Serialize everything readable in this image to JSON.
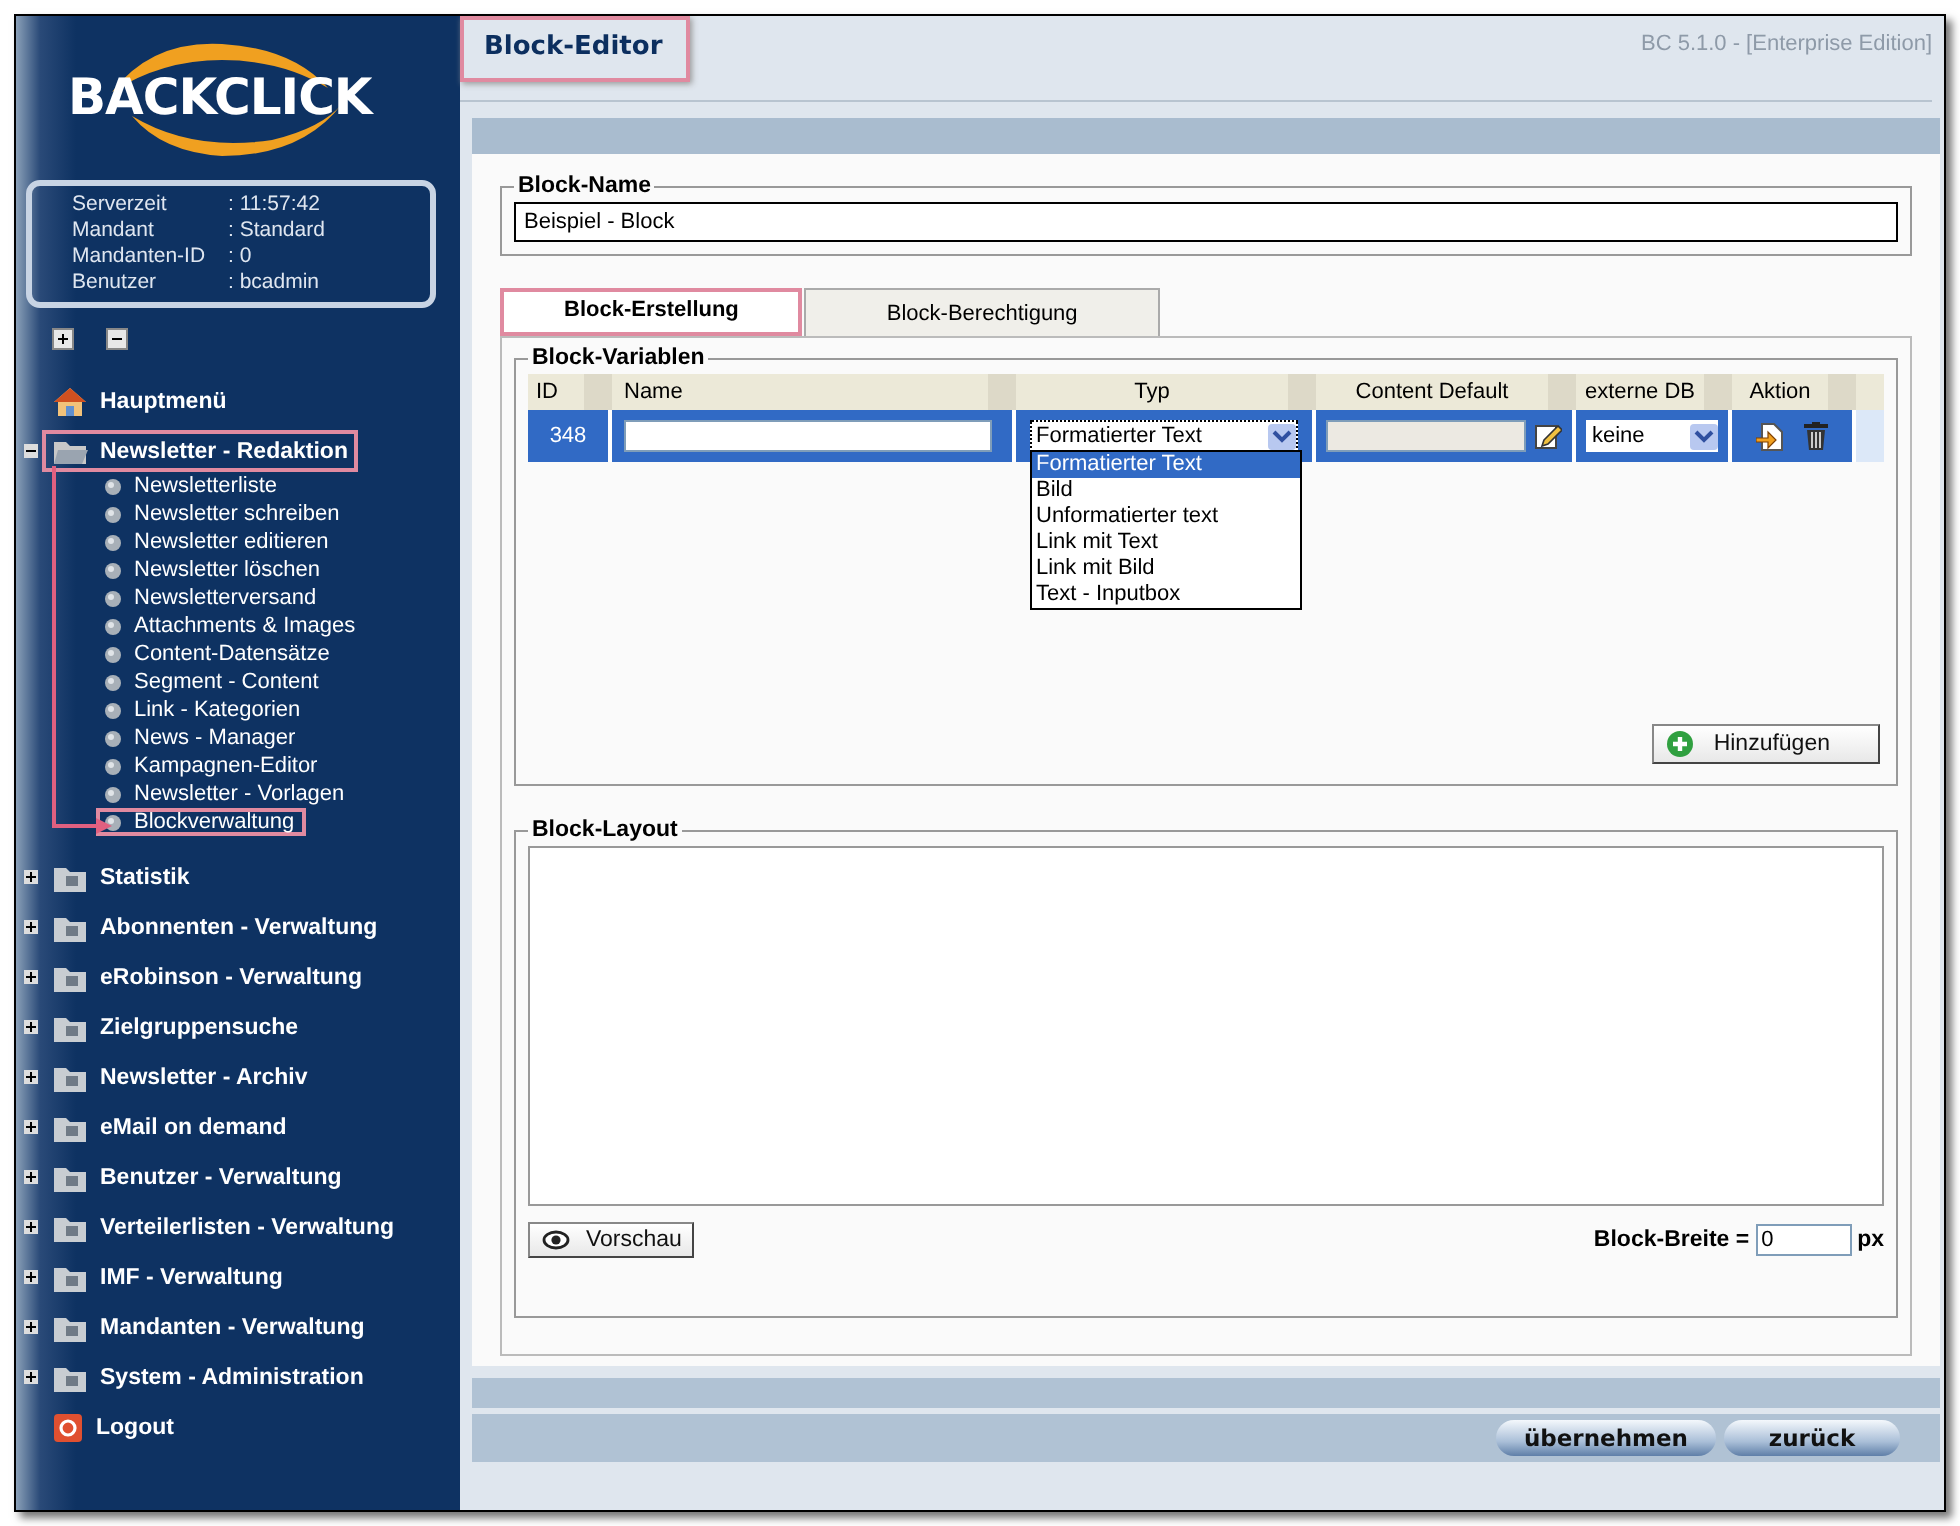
{
  "sidebar": {
    "logo": "BACKCLICK",
    "info": [
      {
        "label": "Serverzeit",
        "value": ": 11:57:42"
      },
      {
        "label": "Mandant",
        "value": ": Standard"
      },
      {
        "label": "Mandanten-ID",
        "value": ": 0"
      },
      {
        "label": "Benutzer",
        "value": ": bcadmin"
      }
    ],
    "menu": [
      {
        "label": "Hauptmenü",
        "kind": "home",
        "highlighted": false
      },
      {
        "label": "Newsletter - Redaktion",
        "kind": "folder",
        "expanded": true,
        "highlighted": true,
        "children": [
          {
            "label": "Newsletterliste",
            "highlighted": false
          },
          {
            "label": "Newsletter schreiben",
            "highlighted": false
          },
          {
            "label": "Newsletter editieren",
            "highlighted": false
          },
          {
            "label": "Newsletter löschen",
            "highlighted": false
          },
          {
            "label": "Newsletterversand",
            "highlighted": false
          },
          {
            "label": "Attachments & Images",
            "highlighted": false
          },
          {
            "label": "Content-Datensätze",
            "highlighted": false
          },
          {
            "label": "Segment - Content",
            "highlighted": false
          },
          {
            "label": "Link - Kategorien",
            "highlighted": false
          },
          {
            "label": "News - Manager",
            "highlighted": false
          },
          {
            "label": "Kampagnen-Editor",
            "highlighted": false
          },
          {
            "label": "Newsletter - Vorlagen",
            "highlighted": false
          },
          {
            "label": "Blockverwaltung",
            "highlighted": true
          }
        ]
      },
      {
        "label": "Statistik",
        "kind": "folder",
        "expanded": false,
        "highlighted": false
      },
      {
        "label": "Abonnenten - Verwaltung",
        "kind": "folder",
        "expanded": false,
        "highlighted": false
      },
      {
        "label": "eRobinson - Verwaltung",
        "kind": "folder",
        "expanded": false,
        "highlighted": false
      },
      {
        "label": "Zielgruppensuche",
        "kind": "folder",
        "expanded": false,
        "highlighted": false
      },
      {
        "label": "Newsletter - Archiv",
        "kind": "folder",
        "expanded": false,
        "highlighted": false
      },
      {
        "label": "eMail on demand",
        "kind": "folder",
        "expanded": false,
        "highlighted": false
      },
      {
        "label": "Benutzer - Verwaltung",
        "kind": "folder",
        "expanded": false,
        "highlighted": false
      },
      {
        "label": "Verteilerlisten - Verwaltung",
        "kind": "folder",
        "expanded": false,
        "highlighted": false
      },
      {
        "label": "IMF - Verwaltung",
        "kind": "folder",
        "expanded": false,
        "highlighted": false
      },
      {
        "label": "Mandanten - Verwaltung",
        "kind": "folder",
        "expanded": false,
        "highlighted": false
      },
      {
        "label": "System - Administration",
        "kind": "folder",
        "expanded": false,
        "highlighted": false
      },
      {
        "label": "Logout",
        "kind": "logout",
        "highlighted": false
      }
    ]
  },
  "page": {
    "title": "Block-Editor",
    "title_highlighted": true,
    "version": "BC 5.1.0 - [Enterprise Edition]"
  },
  "block_name": {
    "legend": "Block-Name",
    "value": "Beispiel - Block"
  },
  "tabs": [
    {
      "label": "Block-Erstellung",
      "selected": true,
      "highlighted": true
    },
    {
      "label": "Block-Berechtigung",
      "selected": false,
      "highlighted": false
    }
  ],
  "variables": {
    "legend": "Block-Variablen",
    "columns": [
      "ID",
      "Name",
      "Typ",
      "Content Default",
      "externe DB",
      "Aktion"
    ],
    "rows": [
      {
        "id": "348",
        "type": "Formatierter Text",
        "external_db": "keine",
        "selected": true
      }
    ],
    "dropdown": {
      "options": [
        {
          "label": "Formatierter Text",
          "selected": true
        },
        {
          "label": "Bild",
          "selected": false
        },
        {
          "label": "Unformatierter text",
          "selected": false
        },
        {
          "label": "Link mit Text",
          "selected": false
        },
        {
          "label": "Link mit Bild",
          "selected": false
        },
        {
          "label": "Text - Inputbox",
          "selected": false
        }
      ]
    },
    "add_button": "Hinzufügen"
  },
  "layout": {
    "legend": "Block-Layout",
    "preview_button": "Vorschau",
    "width_label": "Block-Breite =",
    "width_value": "0",
    "unit": "px"
  },
  "buttons": [
    "übernehmen",
    "zurück"
  ]
}
